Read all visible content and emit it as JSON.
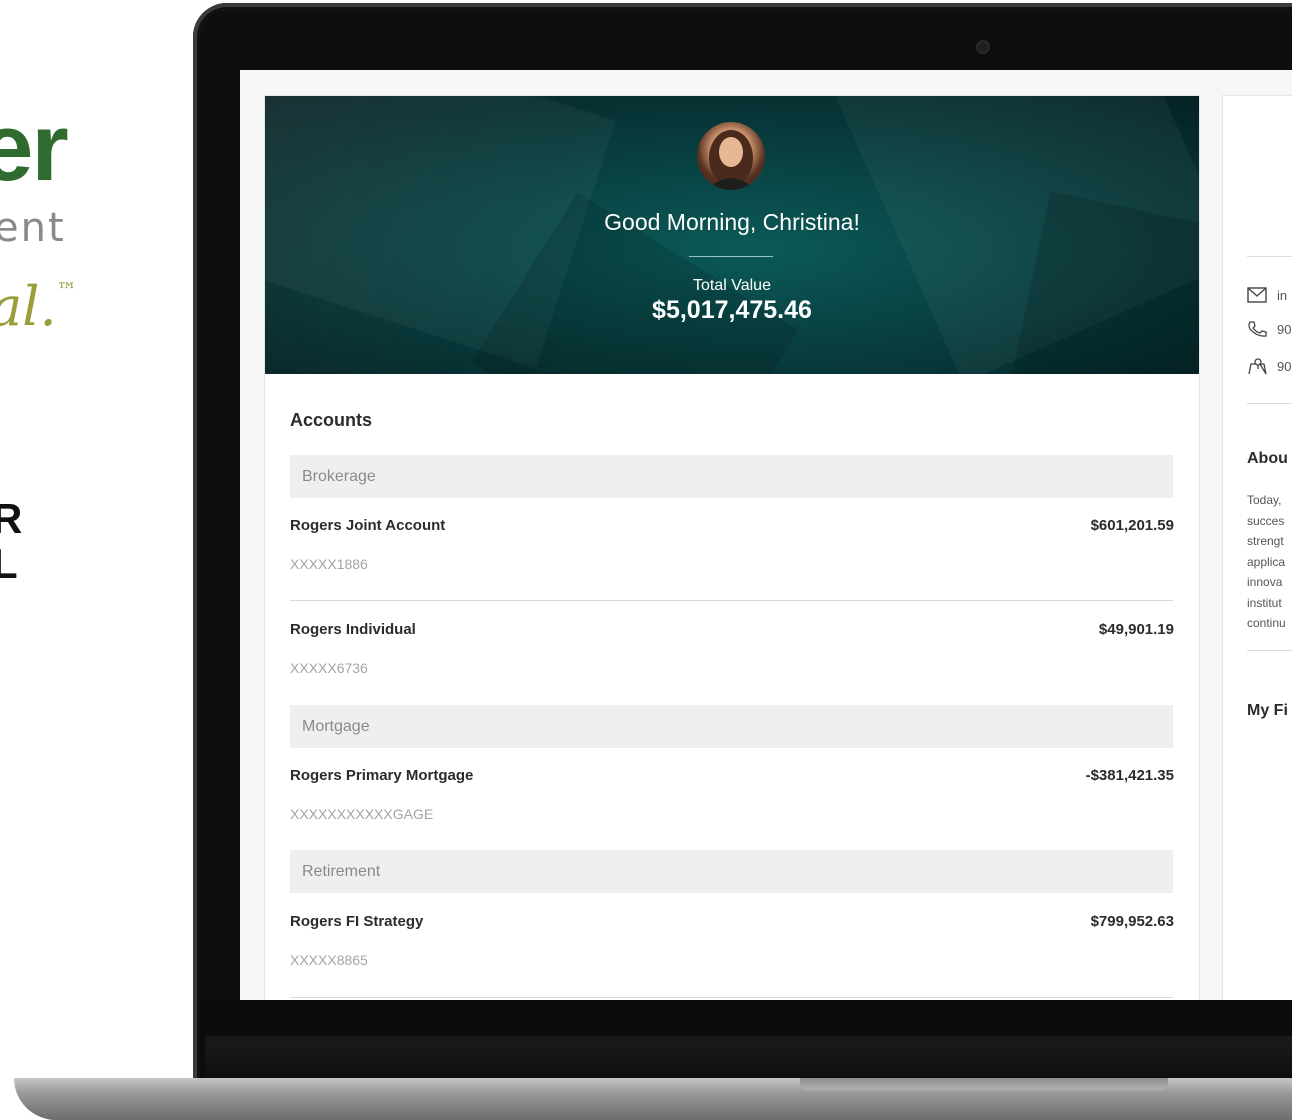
{
  "brand": {
    "word": "er",
    "subtitle": "ent",
    "tagline": "al.",
    "tagline_mark": "™",
    "line_one": "R",
    "line_two": "L"
  },
  "dashboard": {
    "greeting": "Good Morning, Christina!",
    "total_label": "Total Value",
    "total_value": "$5,017,475.46",
    "accounts_title": "Accounts",
    "groups": [
      {
        "name": "Brokerage",
        "accounts": [
          {
            "name": "Rogers Joint Account",
            "number": "XXXXX1886",
            "amount": "$601,201.59"
          },
          {
            "name": "Rogers Individual",
            "number": "XXXXX6736",
            "amount": "$49,901.19"
          }
        ]
      },
      {
        "name": "Mortgage",
        "accounts": [
          {
            "name": "Rogers Primary Mortgage",
            "number": "XXXXXXXXXXXGAGE",
            "amount": "-$381,421.35"
          }
        ]
      },
      {
        "name": "Retirement",
        "accounts": [
          {
            "name": "Rogers FI Strategy",
            "number": "XXXXX8865",
            "amount": "$799,952.63"
          }
        ]
      }
    ]
  },
  "sidebar": {
    "contacts": [
      {
        "icon": "mail-icon",
        "text": "in"
      },
      {
        "icon": "phone-icon",
        "text": "90"
      },
      {
        "icon": "location-icon",
        "text": "90"
      }
    ],
    "about_title": "Abou",
    "about_lines": [
      "Today,",
      "succes",
      "strengt",
      "applica",
      "innova",
      "institut",
      "continu"
    ],
    "my_fi_title": "My Fi"
  }
}
